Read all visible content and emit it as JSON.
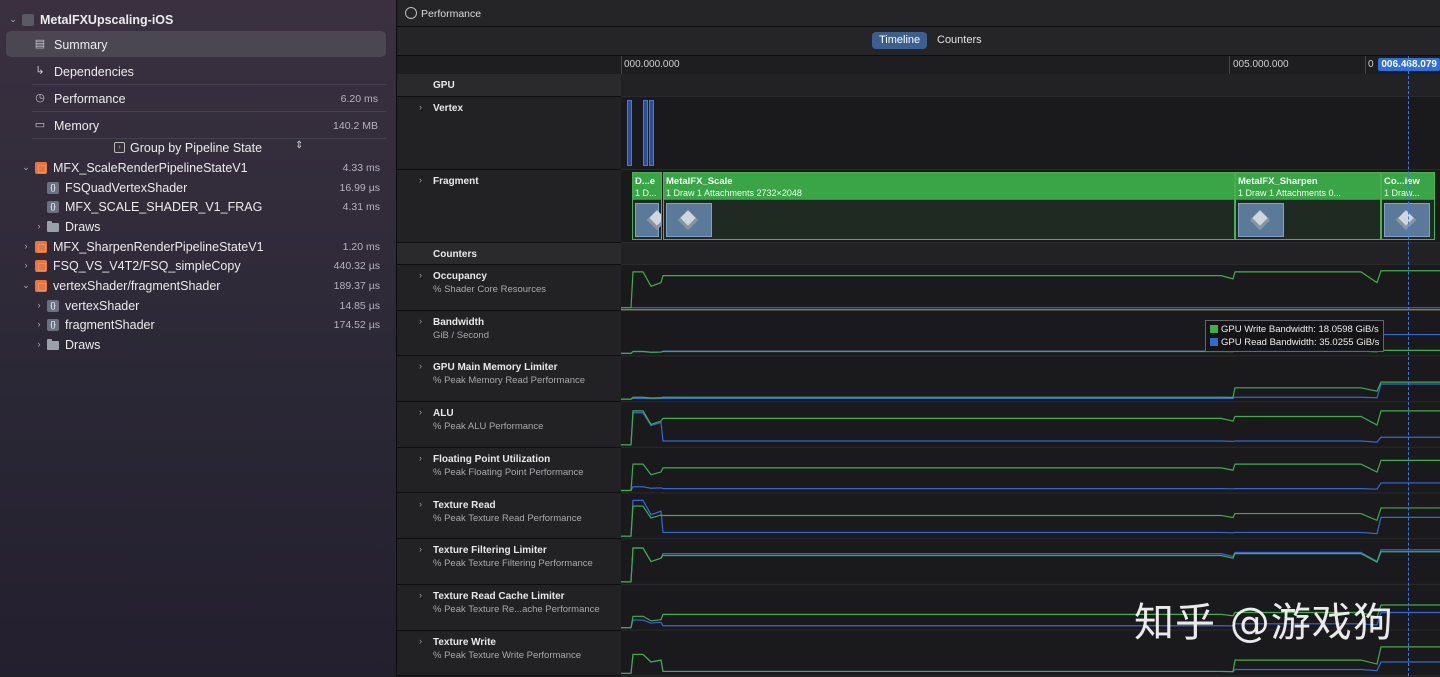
{
  "sidebar": {
    "project": "MetalFXUpscaling-iOS",
    "nav": [
      {
        "label": "Summary",
        "value": "",
        "icon": "summary-icon"
      },
      {
        "label": "Dependencies",
        "value": "",
        "icon": "dependencies-icon"
      },
      {
        "label": "Performance",
        "value": "6.20 ms",
        "icon": "clock-icon"
      },
      {
        "label": "Memory",
        "value": "140.2 MB",
        "icon": "memory-icon"
      }
    ],
    "group_by": "Group by Pipeline State",
    "tree": [
      {
        "label": "MFX_ScaleRenderPipelineStateV1",
        "value": "4.33 ms"
      },
      {
        "label": "FSQuadVertexShader",
        "value": "16.99 µs"
      },
      {
        "label": "MFX_SCALE_SHADER_V1_FRAG",
        "value": "4.31 ms"
      },
      {
        "label": "Draws",
        "value": ""
      },
      {
        "label": "MFX_SharpenRenderPipelineStateV1",
        "value": "1.20 ms"
      },
      {
        "label": "FSQ_VS_V4T2/FSQ_simpleCopy",
        "value": "440.32 µs"
      },
      {
        "label": "vertexShader/fragmentShader",
        "value": "189.37 µs"
      },
      {
        "label": "vertexShader",
        "value": "14.85 µs"
      },
      {
        "label": "fragmentShader",
        "value": "174.52 µs"
      },
      {
        "label": "Draws",
        "value": ""
      }
    ]
  },
  "main": {
    "title": "Performance",
    "tabs": [
      "Timeline",
      "Counters"
    ],
    "ruler": {
      "t0": "000.000.000",
      "t1": "005.000.000",
      "t1_prefix": "0",
      "cursor": "006.468.079"
    },
    "lanes": {
      "gpu": "GPU",
      "vertex": "Vertex",
      "fragment": "Fragment",
      "counters": "Counters"
    },
    "blocks": [
      {
        "name": "D...e",
        "detail": "1 D..."
      },
      {
        "name": "MetalFX_Scale",
        "detail": "1 Draw     1 Attachments     2732×2048"
      },
      {
        "name": "MetalFX_Sharpen",
        "detail": "1 Draw     1 Attachments     0..."
      },
      {
        "name": "Co...iew",
        "detail": "1 Draw..."
      }
    ],
    "counters": [
      {
        "title": "Occupancy",
        "sub": "% Shader Core Resources"
      },
      {
        "title": "Bandwidth",
        "sub": "GiB / Second"
      },
      {
        "title": "GPU Main Memory Limiter",
        "sub": "% Peak Memory Read Performance"
      },
      {
        "title": "ALU",
        "sub": "% Peak ALU Performance"
      },
      {
        "title": "Floating Point Utilization",
        "sub": "% Peak Floating Point Performance"
      },
      {
        "title": "Texture Read",
        "sub": "% Peak Texture Read Performance"
      },
      {
        "title": "Texture Filtering Limiter",
        "sub": "% Peak Texture Filtering Performance"
      },
      {
        "title": "Texture Read Cache Limiter",
        "sub": "% Peak Texture Re...ache Performance"
      },
      {
        "title": "Texture Write",
        "sub": "% Peak Texture Write Performance"
      }
    ],
    "legend": [
      {
        "label": "GPU Write Bandwidth:  18.0598 GiB/s",
        "color": "#3fae49"
      },
      {
        "label": "GPU Read Bandwidth:  35.0255 GiB/s",
        "color": "#3468d6"
      }
    ]
  },
  "watermark": "知乎 @游戏狗",
  "colors": {
    "green": "#3fae49",
    "blue": "#3468d6",
    "accent": "#3b5f8e"
  }
}
